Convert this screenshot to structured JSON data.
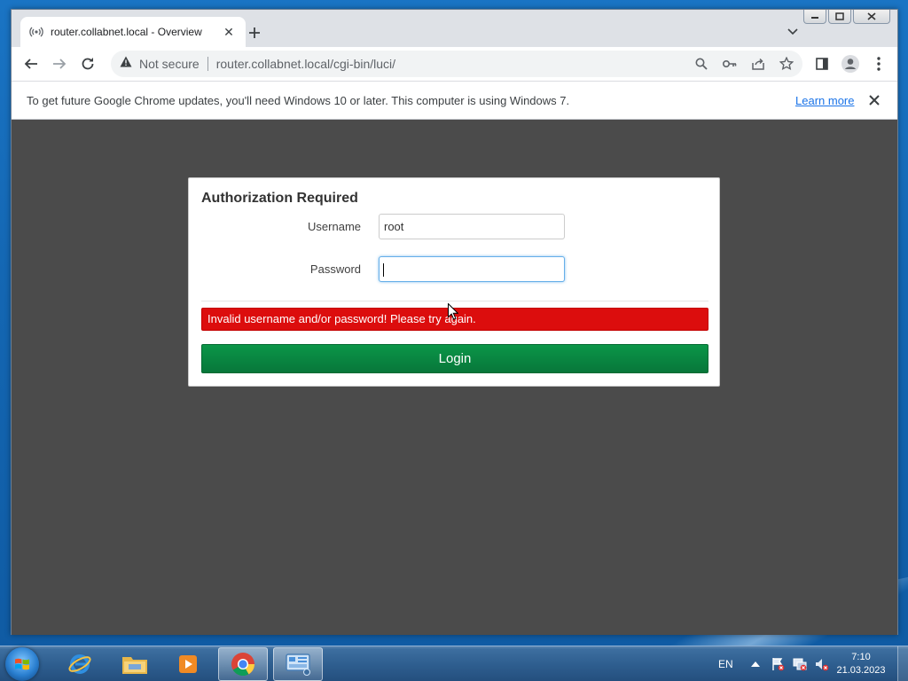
{
  "browser": {
    "tab": {
      "title": "router.collabnet.local - Overview",
      "favicon": "wireless-signal-icon"
    },
    "omnibox": {
      "security_label": "Not secure",
      "url": "router.collabnet.local/cgi-bin/luci/"
    },
    "infobar": {
      "message": "To get future Google Chrome updates, you'll need Windows 10 or later. This computer is using Windows 7.",
      "link_label": "Learn more"
    }
  },
  "login": {
    "title": "Authorization Required",
    "username_label": "Username",
    "username_value": "root",
    "password_label": "Password",
    "password_value": "",
    "error_message": "Invalid username and/or password! Please try again.",
    "login_button": "Login"
  },
  "taskbar": {
    "language": "EN",
    "time": "7:10",
    "date": "21.03.2023",
    "apps": [
      "internet-explorer-icon",
      "file-explorer-icon",
      "media-player-icon",
      "chrome-icon",
      "control-panel-icon"
    ]
  },
  "colors": {
    "page_background": "#4b4b4b",
    "error": "#dc0d0d",
    "login_button": "#0b9648",
    "link": "#1a73e8"
  }
}
